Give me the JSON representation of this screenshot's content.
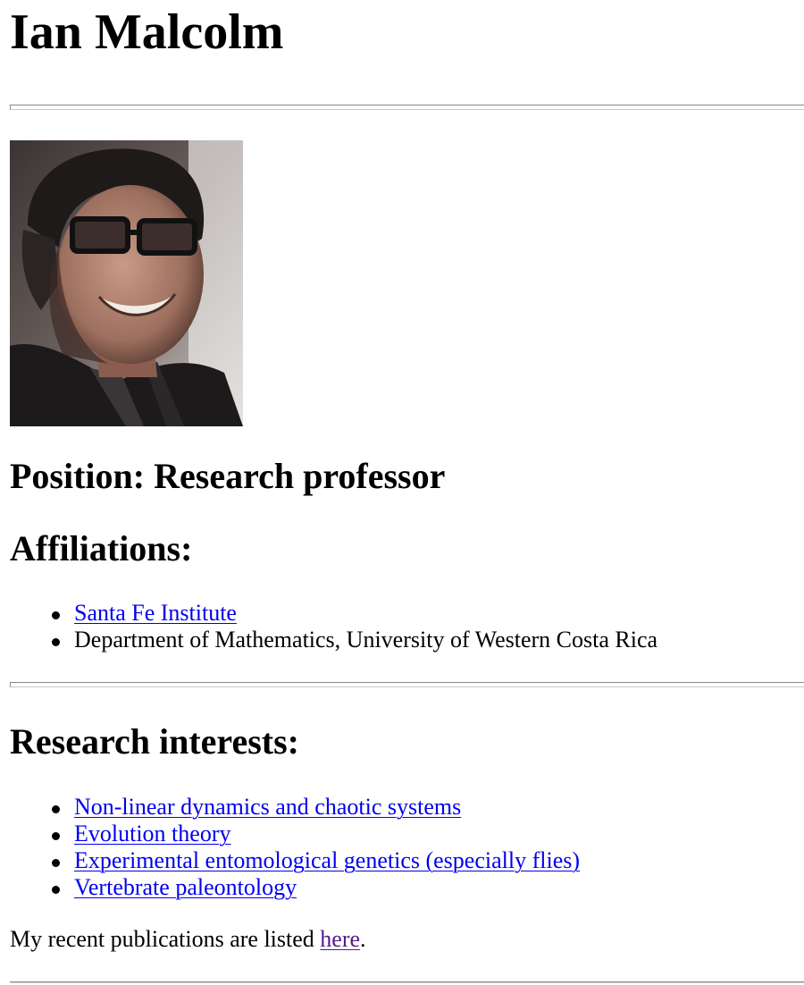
{
  "header": {
    "title": "Ian Malcolm"
  },
  "portrait": {
    "alt": "Portrait of Ian Malcolm"
  },
  "position": {
    "heading": "Position: Research professor"
  },
  "affiliations": {
    "heading": "Affiliations:",
    "items": [
      {
        "label": "Santa Fe Institute",
        "is_link": true
      },
      {
        "label": "Department of Mathematics, University of Western Costa Rica",
        "is_link": false
      }
    ]
  },
  "research": {
    "heading": "Research interests:",
    "items": [
      {
        "label": "Non-linear dynamics and chaotic systems"
      },
      {
        "label": "Evolution theory"
      },
      {
        "label": "Experimental entomological genetics (especially flies)"
      },
      {
        "label": "Vertebrate paleontology"
      }
    ]
  },
  "publications": {
    "prefix": "My recent publications are listed ",
    "link_label": "here",
    "suffix": "."
  },
  "colors": {
    "link": "#0000ee",
    "visited_link": "#551a8b",
    "text": "#000000",
    "background": "#ffffff"
  }
}
